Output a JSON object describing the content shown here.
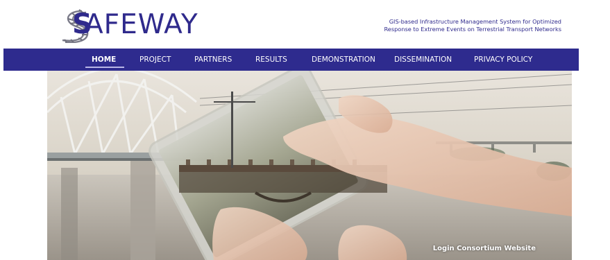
{
  "brand": {
    "logo_text": "AFEWAY",
    "logo_letter": "S",
    "tagline_line1": "GIS-based Infrastructure Management System for Optimized",
    "tagline_line2": "Response to Extreme Events on Terrestrial Transport Networks",
    "color": "#2f2a8c"
  },
  "nav": {
    "background": "#2e2b8e",
    "items": [
      {
        "label": "HOME",
        "active": true
      },
      {
        "label": "PROJECT"
      },
      {
        "label": "PARTNERS"
      },
      {
        "label": "RESULTS"
      },
      {
        "label": "DEMONSTRATION"
      },
      {
        "label": "DISSEMINATION"
      },
      {
        "label": "PRIVACY POLICY"
      }
    ]
  },
  "hero": {
    "image": "railway-bridge-tablet-hand",
    "login_label": "Login Consortium Website"
  }
}
